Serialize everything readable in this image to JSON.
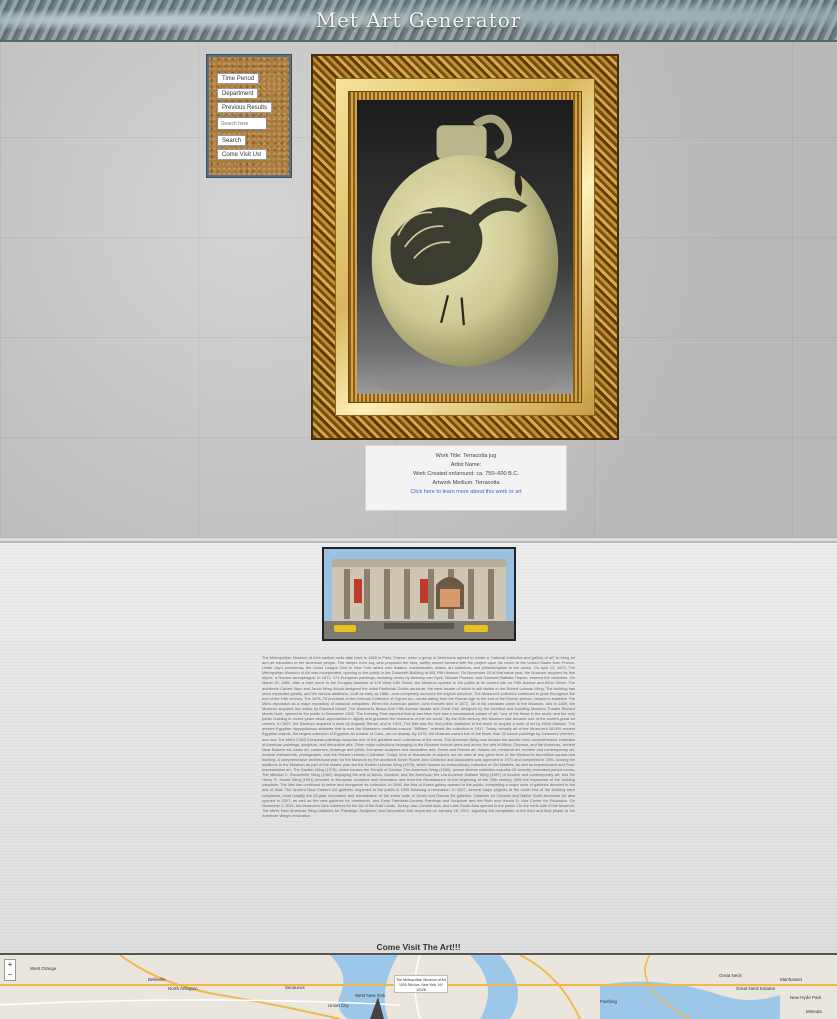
{
  "header": {
    "title": "Met Art Generator"
  },
  "sidebar": {
    "buttons": [
      {
        "key": "time_period",
        "label": "Time Period"
      },
      {
        "key": "department",
        "label": "Department"
      },
      {
        "key": "previous_results",
        "label": "Previous Results"
      }
    ],
    "search": {
      "placeholder": "Search here",
      "button_label": "Search"
    },
    "visit_button": "Come Visit Us!"
  },
  "artwork": {
    "title_line": "Work Title: Terracotta jug",
    "artist_line": "Artist Name:",
    "created_line": "Work Created on/around: ca. 750–600 B.C.",
    "medium_line": "Artwork Medium: Terracotta",
    "link_text": "Click here to learn more about this work or art"
  },
  "museum": {
    "history": "The Metropolitan Museum of Art's earliest roots date back to 1866 in Paris, France, when a group of Americans agreed to create a \"national institution and gallery of art\" to bring art and art education to the American people. The lawyer John Jay, who proposed the idea, swiftly moved forward with the project upon his return to the United States from France. Under Jay's presidency, the Union League Club in New York rallied civic leaders, businessmen, artists, art collectors, and philanthropists to the cause. On April 13, 1870, The Metropolitan Museum of Art was incorporated, opening to the public in the Dodworth Building at 681 Fifth Avenue. On November 20 of that same year, the Museum acquired its first object, a Roman sarcophagus. In 1871, 174 European paintings, including works by Anthony van Dyck, Nicolas Poussin, and Giovanni Battista Tiepolo, entered the collection. On March 30, 1880, after a brief move to the Douglas Mansion at 128 West 14th Street, the Museum opened to the public at its current site on Fifth Avenue and 82nd Street. The architects Calvert Vaux and Jacob Wrey Mould designed the initial Ruskinian Gothic structure, the west facade of which is still visible in the Robert Lehman Wing. The building has since expanded greatly, and the various additions—built as early as 1888—now completely surround the original structure. The Museum's collection continued to grow throughout the end of the 19th century. The 1874–76 purchase of the Cesnola Collection of Cypriot art—works dating from the Bronze Age to the end of the Roman period—helped to establish The Met's reputation as a major repository of classical antiquities. When the American painter John Kensett died in 1872, 38 of his canvases came to the Museum, and in 1889, the Museum acquired two works by Édouard Manet. The Museum's Beaux-Arts Fifth Avenue facade and Great Hall, designed by the architect and founding Museum Trustee Richard Morris Hunt, opened to the public in December 1902. The Evening Post reported that at last New York had a neoclassical palace of art, \"one of the finest in the world, and the only public building in recent years which approaches in dignity and grandeur the museums of the old world.\" By the 20th century, the Museum had become one of the world's great art centers. In 1907, the Museum acquired a work by Auguste Renoir, and in 1910, The Met was the first public institution in the world to acquire a work of art by Henri Matisse. The ancient Egyptian hippopotamus statuette that is now the Museum's unofficial mascot, \"William,\" entered the collection in 1917. Today, virtually all of the Museum's 26,000 ancient Egyptian objects, the largest collection of Egyptian art outside of Cairo, are on display. By 1979, the Museum owned five of the fewer than 35 known paintings by Johannes Vermeer, and now The Met's 2,500 European paintings comprise one of the greatest such collections in the world. The American Wing now houses the world's most comprehensive collection of American paintings, sculpture, and decorative arts. Other major collections belonging to the Museum include arms and armor, the arts of Africa, Oceania, and the Americas, ancient Near Eastern art, Asian art, costumes, drawings and prints, European sculpture and decorative arts, Greek and Roman art, Islamic art, medieval art, modern and contemporary art, musical instruments, photographs, and the Robert Lehman Collection. Today, tens of thousands of objects are on view at any given time in the Museum's two-million-square-foot building. A comprehensive architectural plan for the Museum by the architects Kevin Roche John Dinkeloo and Associates was approved in 1971 and completed in 1991. Among the additions to the Museum as part of the master plan are the Robert Lehman Wing (1975), which houses an extraordinary collection of Old Masters, as well as Impressionist and Post-Impressionist art; The Sackler Wing (1978), which houses the Temple of Dendur; The American Wing (1980), whose diverse collection includes 25 recently renovated period rooms; The Michael C. Rockefeller Wing (1982) displaying the arts of Africa, Oceania, and the Americas; the Lila Acheson Wallace Wing (1987) of modern and contemporary art; and the Henry R. Kravis Wing (1991) devoted to European sculpture and decorative arts from the Renaissance to the beginning of the 20th century. With the expansion of the building complete, The Met has continued to refine and reorganize its collection. In 1998, the Arts of Korea gallery opened to the public, completing a major suite of galleries devoted to the arts of Asia. The Ancient Near Eastern Art galleries reopened to the public in 1999 following a renovation. In 2007, several major projects at the south end of the building were completed, most notably the 15-year renovation and reinstallation of the entire suite of Greek and Roman Art galleries. Galleries for Oceanic and Native North American Art also opened in 2007, as well as the new galleries for nineteenth- and Early Twentieth-Century Paintings and Sculpture and the Ruth and Harold D. Uris Center for Education. On November 1, 2011, the Museum's New Galleries for the Art of the Arab Lands, Turkey, Iran, Central Asia, and Later South Asia opened to the public. On the north side of the Museum, The Met's New American Wing Galleries for Paintings, Sculpture, and Decorative Arts reopened on January 16, 2012, signaling the completion of the third and final phase of the American Wing's renovation.",
    "visit_heading": "Come Visit The Art!!!"
  },
  "map": {
    "zoom_in": "+",
    "zoom_out": "−",
    "popup_line1": "The Metropolitan Museum of Art",
    "popup_line2": "1000 5th Ave, New York, NY 10028",
    "places": {
      "west_orange": "West Orange",
      "belleville": "Belleville",
      "north_arlington": "North Arlington",
      "secaucus": "Secaucus",
      "union_city": "Union City",
      "west_new_york": "West New York",
      "great_neck": "Great Neck",
      "manhasset": "Manhasset",
      "great_neck_estates": "Great Neck Estates",
      "flushing": "Flushing",
      "new_hyde_park": "New Hyde Park",
      "mineola": "Mineola"
    }
  }
}
